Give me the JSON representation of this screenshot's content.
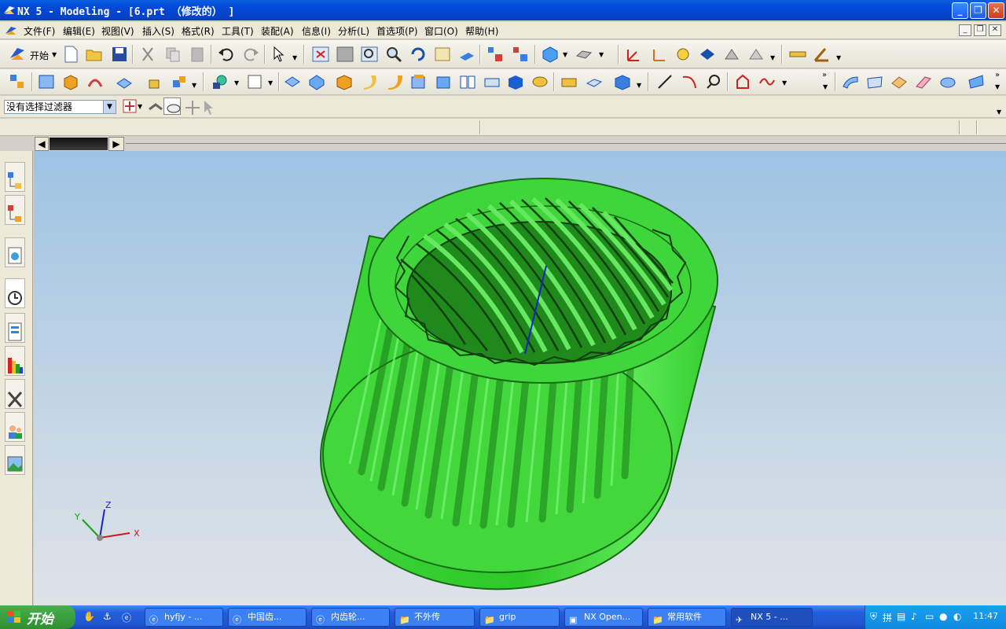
{
  "window": {
    "title": "NX 5 - Modeling - [6.prt （修改的） ]"
  },
  "menu": {
    "items": [
      "文件(F)",
      "编辑(E)",
      "视图(V)",
      "插入(S)",
      "格式(R)",
      "工具(T)",
      "装配(A)",
      "信息(I)",
      "分析(L)",
      "首选项(P)",
      "窗口(O)",
      "帮助(H)"
    ]
  },
  "toolbar": {
    "start_label": "开始"
  },
  "filter": {
    "value": "没有选择过滤器"
  },
  "axes": {
    "x": "X",
    "y": "Y",
    "z": "Z"
  },
  "taskbar": {
    "start": "开始",
    "tasks": [
      "hyfjy - ...",
      "中国齿...",
      "内齿轮...",
      "不外传",
      "grip",
      "NX Open...",
      "常用软件",
      "NX 5 - ..."
    ],
    "clock": "11:47"
  },
  "colors": {
    "gear": "#39d835",
    "title": "#0a5ee0"
  }
}
